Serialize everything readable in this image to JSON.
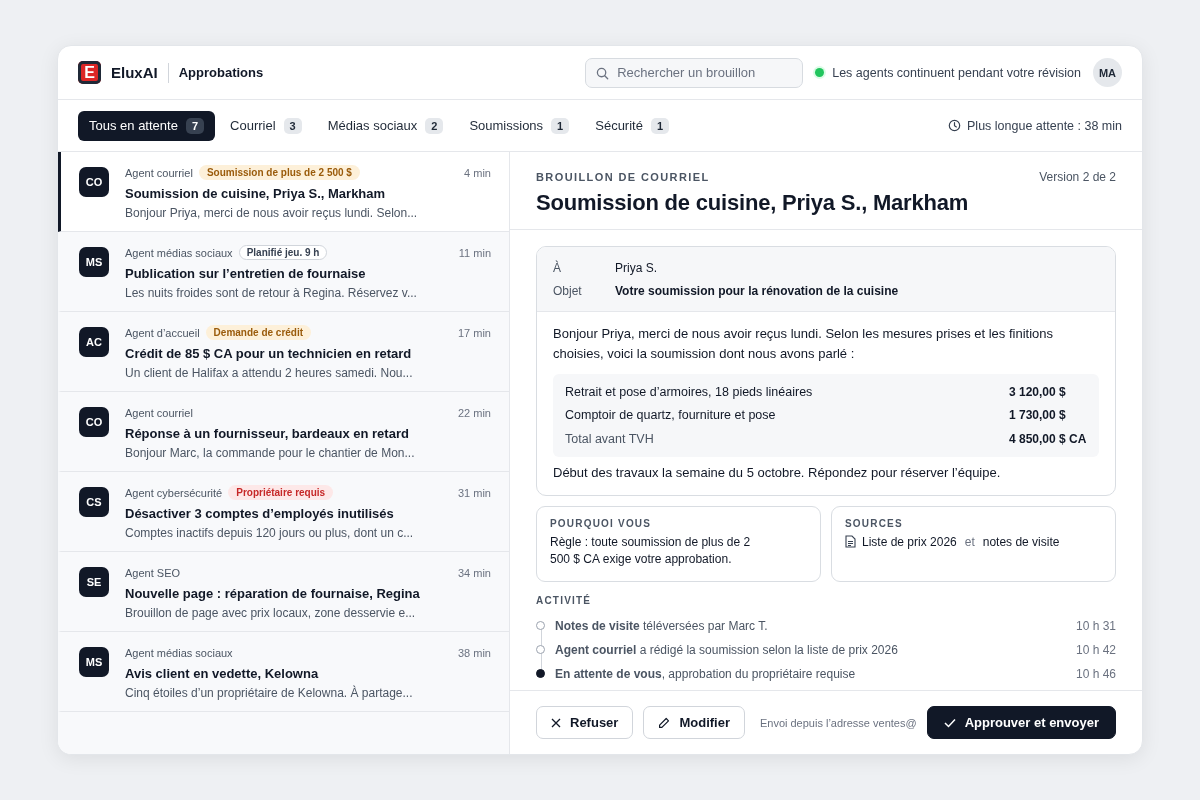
{
  "app": {
    "logo_letter": "E",
    "name": "EluxAI",
    "section": "Approbations"
  },
  "search": {
    "placeholder": "Rechercher un brouillon"
  },
  "status": {
    "text": "Les agents continuent pendant votre révision",
    "on": true
  },
  "user": {
    "initials": "MA"
  },
  "tabs": [
    {
      "label": "Tous en attente",
      "count": "7",
      "selected": true
    },
    {
      "label": "Courriel",
      "count": "3",
      "selected": false
    },
    {
      "label": "Médias sociaux",
      "count": "2",
      "selected": false
    },
    {
      "label": "Soumissions",
      "count": "1",
      "selected": false
    },
    {
      "label": "Sécurité",
      "count": "1",
      "selected": false
    }
  ],
  "longest_wait": "Plus longue attente : 38 min",
  "drafts": [
    {
      "initials": "CO",
      "agent": "Agent courriel",
      "tag": {
        "label": "Soumission de plus de 2 500 $",
        "kind": "warning"
      },
      "time": "4 min",
      "title": "Soumission de cuisine, Priya S., Markham",
      "preview": "Bonjour Priya, merci de nous avoir reçus lundi. Selon...",
      "selected": true
    },
    {
      "initials": "MS",
      "agent": "Agent médias sociaux",
      "tag": {
        "label": "Planifié jeu. 9 h",
        "kind": "outline"
      },
      "time": "11 min",
      "title": "Publication sur l’entretien de fournaise",
      "preview": "Les nuits froides sont de retour à Regina. Réservez v...",
      "selected": false
    },
    {
      "initials": "AC",
      "agent": "Agent d’accueil",
      "tag": {
        "label": "Demande de crédit",
        "kind": "warning"
      },
      "time": "17 min",
      "title": "Crédit de 85 $ CA pour un technicien en retard",
      "preview": "Un client de Halifax a attendu 2 heures samedi. Nou...",
      "selected": false
    },
    {
      "initials": "CO",
      "agent": "Agent courriel",
      "time": "22 min",
      "title": "Réponse à un fournisseur, bardeaux en retard",
      "preview": "Bonjour Marc, la commande pour le chantier de Mon...",
      "selected": false
    },
    {
      "initials": "CS",
      "agent": "Agent cybersécurité",
      "tag": {
        "label": "Propriétaire requis",
        "kind": "danger"
      },
      "time": "31 min",
      "title": "Désactiver 3 comptes d’employés inutilisés",
      "preview": "Comptes inactifs depuis 120 jours ou plus, dont un c...",
      "selected": false
    },
    {
      "initials": "SE",
      "agent": "Agent SEO",
      "time": "34 min",
      "title": "Nouvelle page : réparation de fournaise, Regina",
      "preview": "Brouillon de page avec prix locaux, zone desservie e...",
      "selected": false
    },
    {
      "initials": "MS",
      "agent": "Agent médias sociaux",
      "time": "38 min",
      "title": "Avis client en vedette, Kelowna",
      "preview": "Cinq étoiles d’un propriétaire de Kelowna. À partage...",
      "selected": false
    }
  ],
  "detail": {
    "eyebrow": "BROUILLON DE COURRIEL",
    "version": "Version 2 de 2",
    "title": "Soumission de cuisine, Priya S., Markham",
    "email": {
      "fields": [
        {
          "label": "À",
          "value": "Priya S.",
          "kind": "plain"
        },
        {
          "label": "Objet",
          "value": "Votre soumission pour la rénovation de la cuisine",
          "kind": "strong"
        }
      ],
      "intro": "Bonjour Priya, merci de nous avoir reçus lundi. Selon les mesures prises et les finitions choisies, voici la soumission dont nous avons parlé :",
      "lines": [
        {
          "label": "Retrait et pose d’armoires, 18 pieds linéaires",
          "amount": "3 120,00 $",
          "kind": "line"
        },
        {
          "label": "Comptoir de quartz, fourniture et pose",
          "amount": "1 730,00 $",
          "kind": "line"
        },
        {
          "label": "Total avant TVH",
          "amount": "4 850,00 $ CA",
          "kind": "total"
        }
      ],
      "closing": "Début des travaux la semaine du 5 octobre. Répondez pour réserver l’équipe."
    },
    "why": {
      "heading": "POURQUOI VOUS",
      "text": "Règle : toute soumission de plus de 2 500 $ CA exige votre approbation."
    },
    "sources": {
      "heading": "SOURCES",
      "items": [
        "Liste de prix 2026",
        "notes de visite"
      ],
      "joiner": "et"
    },
    "activity": {
      "heading": "ACTIVITÉ",
      "items": [
        {
          "text": "**Notes de visite** téléversées par Marc T.",
          "time": "10 h 31",
          "current": false
        },
        {
          "text": "**Agent courriel** a rédigé la soumission selon la liste de prix 2026",
          "time": "10 h 42",
          "current": false
        },
        {
          "text": "**En attente de vous**, approbation du propriétaire requise",
          "time": "10 h 46",
          "current": true
        }
      ]
    },
    "actions": {
      "reject": "Refuser",
      "edit": "Modifier",
      "sender_note": "Envoi depuis l’adresse ventes@",
      "approve": "Approuver et envoyer"
    }
  }
}
